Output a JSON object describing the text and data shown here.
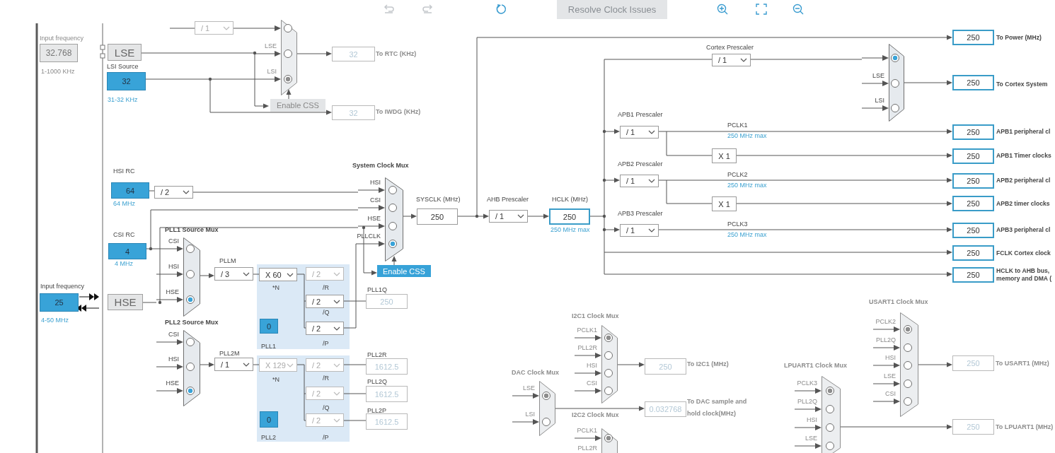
{
  "toolbar": {
    "resolve_button": {
      "label": "Resolve Clock Issues",
      "disabled": true
    }
  },
  "labels": [
    {
      "text": "Input frequency",
      "kind": "label"
    },
    {
      "text": "1-1000 KHz",
      "kind": "label"
    },
    {
      "text": "LSI Source",
      "kind": "dark"
    },
    {
      "text": "31-32 KHz",
      "kind": "note"
    },
    {
      "text": "To RTC (KHz)",
      "kind": "muted_output"
    },
    {
      "text": "To IWDG (KHz)",
      "kind": "muted_output"
    },
    {
      "text": "HSI RC",
      "kind": "dark"
    },
    {
      "text": "64 MHz",
      "kind": "note"
    },
    {
      "text": "System Clock Mux",
      "kind": "title"
    },
    {
      "text": "SYSCLK (MHz)",
      "kind": "dark"
    },
    {
      "text": "AHB Prescaler",
      "kind": "dark"
    },
    {
      "text": "HCLK (MHz)",
      "kind": "dark"
    },
    {
      "text": "250 MHz max",
      "kind": "note"
    },
    {
      "text": "CSI RC",
      "kind": "dark"
    },
    {
      "text": "4 MHz",
      "kind": "note"
    },
    {
      "text": "PLL1 Source Mux",
      "kind": "title"
    },
    {
      "text": "Input frequency",
      "kind": "dark"
    },
    {
      "text": "4-50 MHz",
      "kind": "note"
    },
    {
      "text": "PLLM",
      "kind": "dark"
    },
    {
      "text": "*N",
      "kind": "dark"
    },
    {
      "text": "/R",
      "kind": "dark"
    },
    {
      "text": "/Q",
      "kind": "dark"
    },
    {
      "text": "/P",
      "kind": "dark"
    },
    {
      "text": "PLL1",
      "kind": "dark"
    },
    {
      "text": "PLL1Q",
      "kind": "dark"
    },
    {
      "text": "PLL2 Source Mux",
      "kind": "title"
    },
    {
      "text": "PLL2M",
      "kind": "dark"
    },
    {
      "text": "*N",
      "kind": "dark"
    },
    {
      "text": "/R",
      "kind": "dark"
    },
    {
      "text": "/Q",
      "kind": "dark"
    },
    {
      "text": "/P",
      "kind": "dark"
    },
    {
      "text": "PLL2",
      "kind": "dark"
    },
    {
      "text": "PLL2R",
      "kind": "dark"
    },
    {
      "text": "PLL2Q",
      "kind": "dark"
    },
    {
      "text": "PLL2P",
      "kind": "dark"
    },
    {
      "text": "To Power (MHz)",
      "kind": "output"
    },
    {
      "text": "Cortex Prescaler",
      "kind": "dark"
    },
    {
      "text": "To Cortex System",
      "kind": "output"
    },
    {
      "text": "APB1 Prescaler",
      "kind": "dark"
    },
    {
      "text": "PCLK1",
      "kind": "dark"
    },
    {
      "text": "250 MHz max",
      "kind": "note"
    },
    {
      "text": "APB1 peripheral cl",
      "kind": "output"
    },
    {
      "text": "APB1 Timer clocks",
      "kind": "output"
    },
    {
      "text": "APB2 Prescaler",
      "kind": "dark"
    },
    {
      "text": "PCLK2",
      "kind": "dark"
    },
    {
      "text": "250 MHz max",
      "kind": "note"
    },
    {
      "text": "APB2 peripheral cl",
      "kind": "output"
    },
    {
      "text": "APB2 timer clocks",
      "kind": "output"
    },
    {
      "text": "APB3 Prescaler",
      "kind": "dark"
    },
    {
      "text": "PCLK3",
      "kind": "dark"
    },
    {
      "text": "250 MHz max",
      "kind": "note"
    },
    {
      "text": "APB3 peripheral cl",
      "kind": "output"
    },
    {
      "text": "FCLK Cortex clock",
      "kind": "output"
    },
    {
      "text": "HCLK to AHB bus,",
      "kind": "output"
    },
    {
      "text": "memory and DMA (",
      "kind": "output"
    },
    {
      "text": "I2C1 Clock Mux",
      "kind": "muted_title"
    },
    {
      "text": "To I2C1 (MHz)",
      "kind": "muted_output"
    },
    {
      "text": "DAC Clock Mux",
      "kind": "muted_title"
    },
    {
      "text": "To DAC sample and",
      "kind": "muted_output"
    },
    {
      "text": "I2C2 Clock Mux",
      "kind": "muted_title"
    },
    {
      "text": "hold clock(MHz)",
      "kind": "muted_output"
    },
    {
      "text": "USART1 Clock Mux",
      "kind": "muted_title"
    },
    {
      "text": "LPUART1 Clock Mux",
      "kind": "muted_title"
    },
    {
      "text": "To USART1 (MHz)",
      "kind": "muted_output"
    },
    {
      "text": "To LPUART1 (MHz)",
      "kind": "muted_output"
    }
  ],
  "fields": [
    {
      "value": "32.768",
      "kind": "fixed"
    },
    {
      "value": "LSE",
      "kind": "source"
    },
    {
      "value": "32",
      "kind": "input"
    },
    {
      "value": "32",
      "kind": "dim"
    },
    {
      "value": "32",
      "kind": "dim"
    },
    {
      "value": "64",
      "kind": "input"
    },
    {
      "value": "250",
      "kind": "output"
    },
    {
      "value": "250",
      "kind": "highlight"
    },
    {
      "value": "4",
      "kind": "input"
    },
    {
      "value": "25",
      "kind": "input"
    },
    {
      "value": "HSE",
      "kind": "source"
    },
    {
      "value": "0",
      "kind": "input"
    },
    {
      "value": "250",
      "kind": "dim"
    },
    {
      "value": "0",
      "kind": "input"
    },
    {
      "value": "1612.5",
      "kind": "dim"
    },
    {
      "value": "1612.5",
      "kind": "dim"
    },
    {
      "value": "1612.5",
      "kind": "dim"
    },
    {
      "value": "250",
      "kind": "highlight"
    },
    {
      "value": "250",
      "kind": "highlight"
    },
    {
      "value": "250",
      "kind": "highlight"
    },
    {
      "value": "X 1",
      "kind": "output"
    },
    {
      "value": "250",
      "kind": "highlight"
    },
    {
      "value": "250",
      "kind": "highlight"
    },
    {
      "value": "X 1",
      "kind": "output"
    },
    {
      "value": "250",
      "kind": "highlight"
    },
    {
      "value": "250",
      "kind": "highlight"
    },
    {
      "value": "250",
      "kind": "highlight"
    },
    {
      "value": "250",
      "kind": "highlight"
    },
    {
      "value": "250",
      "kind": "dim"
    },
    {
      "value": "0.032768",
      "kind": "dim"
    },
    {
      "value": "250",
      "kind": "dim"
    },
    {
      "value": "250",
      "kind": "dim"
    }
  ],
  "dropdowns": [
    {
      "value": "/ 1",
      "disabled": true
    },
    {
      "value": "/ 2",
      "disabled": false
    },
    {
      "value": "/ 1",
      "disabled": false
    },
    {
      "value": "/ 3",
      "disabled": false
    },
    {
      "value": "X 60",
      "disabled": false
    },
    {
      "value": "/ 2",
      "disabled": true
    },
    {
      "value": "/ 2",
      "disabled": false
    },
    {
      "value": "/ 2",
      "disabled": false
    },
    {
      "value": "/ 1",
      "disabled": false
    },
    {
      "value": "X 129",
      "disabled": true
    },
    {
      "value": "/ 2",
      "disabled": true
    },
    {
      "value": "/ 2",
      "disabled": true
    },
    {
      "value": "/ 2",
      "disabled": true
    },
    {
      "value": "/ 1",
      "disabled": false
    },
    {
      "value": "/ 1",
      "disabled": false
    },
    {
      "value": "/ 1",
      "disabled": false
    },
    {
      "value": "/ 1",
      "disabled": false
    }
  ],
  "buttons": [
    {
      "label": "Enable CSS",
      "disabled": true
    },
    {
      "label": "Enable CSS",
      "disabled": false
    }
  ],
  "muxes": [
    {
      "disabled": true,
      "options": [
        {
          "selected": false
        },
        {
          "label": "LSE",
          "selected": false
        },
        {
          "label": "LSI",
          "selected": true
        }
      ]
    },
    {
      "disabled": false,
      "options": [
        {
          "label": "HSI",
          "selected": false
        },
        {
          "label": "CSI",
          "selected": false
        },
        {
          "label": "HSE",
          "selected": false
        },
        {
          "label": "PLLCLK",
          "selected": true
        }
      ]
    },
    {
      "disabled": false,
      "options": [
        {
          "label": "CSI",
          "selected": false
        },
        {
          "label": "HSI",
          "selected": false
        },
        {
          "label": "HSE",
          "selected": true
        }
      ]
    },
    {
      "disabled": false,
      "options": [
        {
          "label": "CSI",
          "selected": false
        },
        {
          "label": "HSI",
          "selected": false
        },
        {
          "label": "HSE",
          "selected": true
        }
      ]
    },
    {
      "disabled": false,
      "options": [
        {
          "selected": true
        },
        {
          "label": "LSE",
          "selected": false
        },
        {
          "label": "LSI",
          "selected": false
        }
      ]
    },
    {
      "disabled": true,
      "options": [
        {
          "label": "PCLK1",
          "selected": true
        },
        {
          "label": "PLL2R",
          "selected": false
        },
        {
          "label": "HSI",
          "selected": false
        },
        {
          "label": "CSI",
          "selected": false
        }
      ]
    },
    {
      "disabled": true,
      "options": [
        {
          "label": "LSE",
          "selected": true
        },
        {
          "label": "LSI",
          "selected": false
        }
      ]
    },
    {
      "disabled": true,
      "options": [
        {
          "label": "PCLK1",
          "selected": true
        },
        {
          "label": "PLL2R"
        }
      ]
    },
    {
      "disabled": true,
      "options": [
        {
          "label": "PCLK2",
          "selected": true
        },
        {
          "label": "PLL2Q",
          "selected": false
        },
        {
          "label": "HSI",
          "selected": false
        },
        {
          "label": "LSE",
          "selected": false
        },
        {
          "label": "CSI",
          "selected": false
        }
      ]
    },
    {
      "disabled": true,
      "options": [
        {
          "label": "PCLK3",
          "selected": true
        },
        {
          "label": "PLL2Q",
          "selected": false
        },
        {
          "label": "HSI",
          "selected": false
        },
        {
          "label": "LSE",
          "selected": false
        }
      ]
    }
  ]
}
